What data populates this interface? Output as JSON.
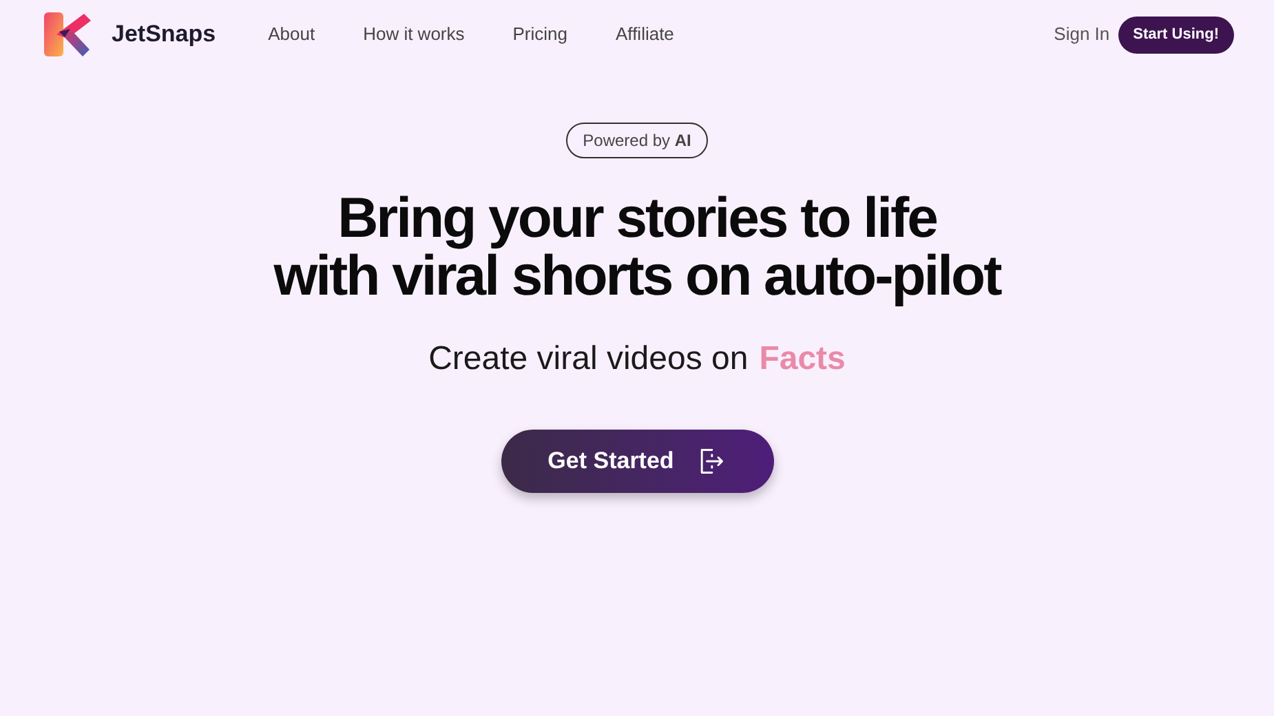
{
  "brand": {
    "name": "JetSnaps"
  },
  "nav": {
    "links": [
      "About",
      "How it works",
      "Pricing",
      "Affiliate"
    ],
    "sign_in": "Sign In",
    "cta": "Start Using!"
  },
  "hero": {
    "badge": "Powered by **AI**",
    "headline": [
      "Bring your stories to life",
      "with viral shorts on auto-pilot"
    ],
    "subtitle": "Create viral videos on",
    "rotating_word": {
      "text": "Facts",
      "color": "#e98aa8"
    },
    "button": "Get Started"
  }
}
